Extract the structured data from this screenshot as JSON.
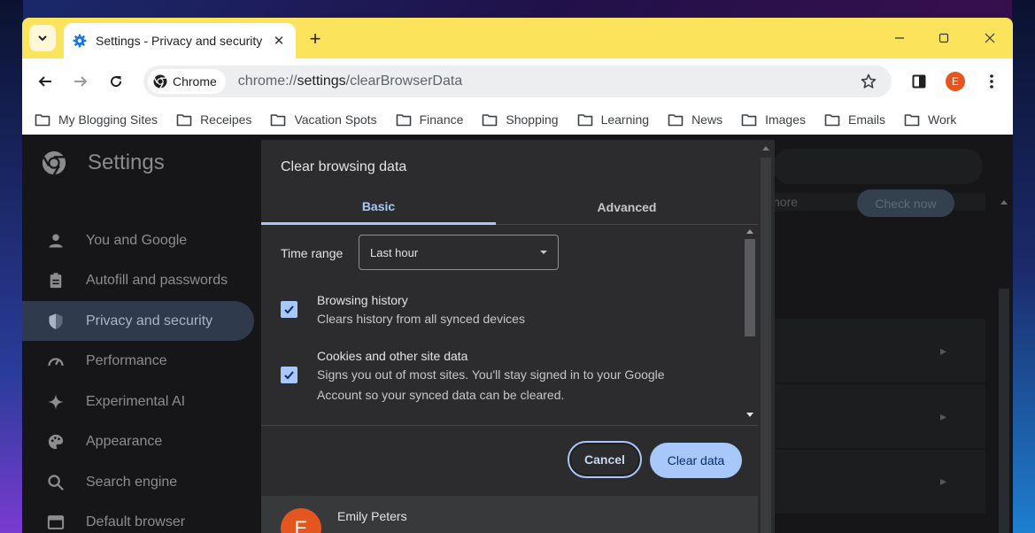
{
  "tab": {
    "title": "Settings - Privacy and security",
    "close": "✕"
  },
  "new_tab": "+",
  "toolbar": {
    "chip_label": "Chrome",
    "url_scheme": "chrome://",
    "url_host": "settings",
    "url_path": "/clearBrowserData",
    "profile_initial": "E"
  },
  "bookmarks": [
    "My Blogging Sites",
    "Receipes",
    "Vacation Spots",
    "Finance",
    "Shopping",
    "Learning",
    "News",
    "Images",
    "Emails",
    "Work"
  ],
  "settings": {
    "title": "Settings",
    "nav": [
      {
        "label": "You and Google",
        "icon": "person-icon"
      },
      {
        "label": "Autofill and passwords",
        "icon": "clipboard-icon"
      },
      {
        "label": "Privacy and security",
        "icon": "shield-icon",
        "active": true
      },
      {
        "label": "Performance",
        "icon": "gauge-icon"
      },
      {
        "label": "Experimental AI",
        "icon": "sparkle-icon"
      },
      {
        "label": "Appearance",
        "icon": "palette-icon"
      },
      {
        "label": "Search engine",
        "icon": "search-icon"
      },
      {
        "label": "Default browser",
        "icon": "browser-icon"
      }
    ],
    "more_text": "nore",
    "check_now": "Check now"
  },
  "dialog": {
    "title": "Clear browsing data",
    "tabs": [
      "Basic",
      "Advanced"
    ],
    "time_range_label": "Time range",
    "time_range_value": "Last hour",
    "items": [
      {
        "title": "Browsing history",
        "subtitle": "Clears history from all synced devices",
        "checked": true
      },
      {
        "title": "Cookies and other site data",
        "subtitle": "Signs you out of most sites. You'll stay signed in to your Google Account so your synced data can be cleared.",
        "checked": true
      }
    ],
    "cancel": "Cancel",
    "clear": "Clear data",
    "account_name": "Emily Peters",
    "account_initial": "E"
  },
  "colors": {
    "tabstrip": "#fbe35c",
    "accent": "#a8c7fa",
    "avatar": "#e4551f",
    "dialog_bg": "#2c2c2e"
  }
}
